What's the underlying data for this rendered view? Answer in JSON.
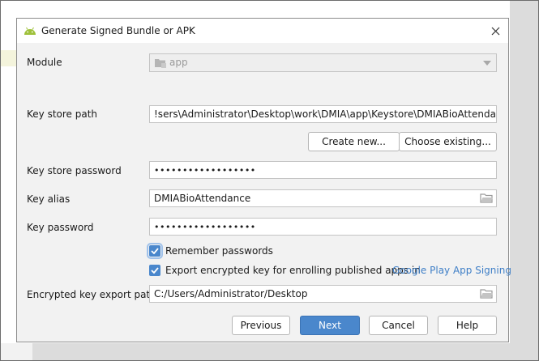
{
  "dialog": {
    "title": "Generate Signed Bundle or APK",
    "module": {
      "label": "Module",
      "value": "app"
    },
    "key_store_path": {
      "label": "Key store path",
      "value": "!sers\\Administrator\\Desktop\\work\\DMIA\\app\\Keystore\\DMIABioAttendance.jks"
    },
    "create_new_label": "Create new...",
    "choose_existing_label": "Choose existing...",
    "key_store_password": {
      "label": "Key store password",
      "value": "••••••••••••••••••"
    },
    "key_alias": {
      "label": "Key alias",
      "value": "DMIABioAttendance"
    },
    "key_password": {
      "label": "Key password",
      "value": "••••••••••••••••••"
    },
    "remember_passwords": {
      "label": "Remember passwords",
      "checked": true
    },
    "export_key": {
      "label": "Export encrypted key for enrolling published apps in",
      "link": "Google Play App Signing",
      "checked": true
    },
    "encrypted_export_path": {
      "label": "Encrypted key export path",
      "value": "C:/Users/Administrator/Desktop"
    },
    "buttons": {
      "previous": "Previous",
      "next": "Next",
      "cancel": "Cancel",
      "help": "Help"
    }
  },
  "colors": {
    "accent": "#4a87cc",
    "link": "#3f7fc7",
    "dialog_bg": "#f2f2f2"
  }
}
